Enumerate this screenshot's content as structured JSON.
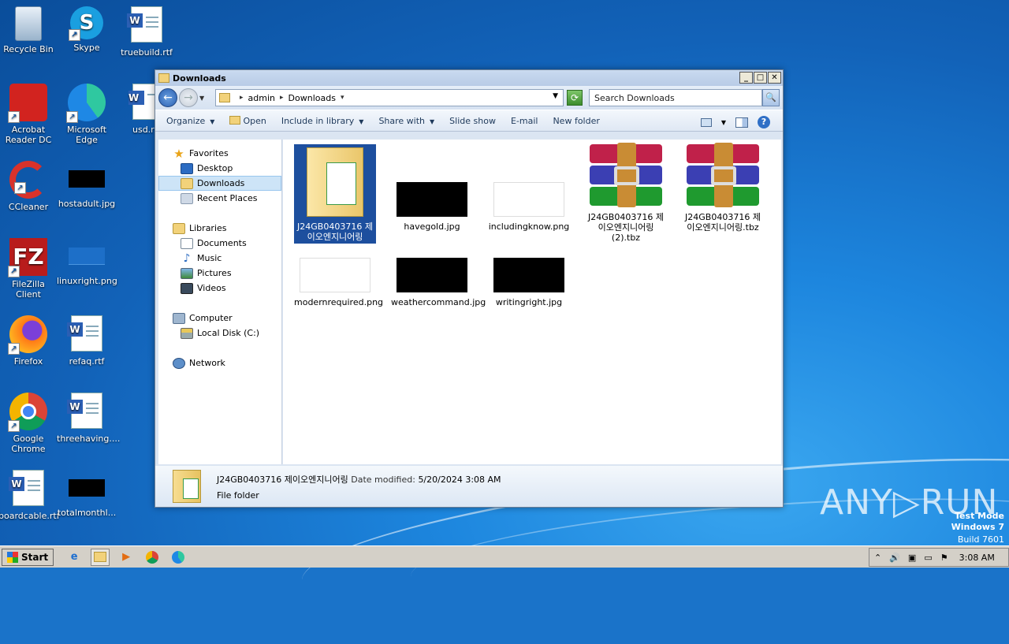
{
  "desktop": {
    "icons": [
      {
        "label": "Recycle Bin"
      },
      {
        "label": "Skype"
      },
      {
        "label": "truebuild.rtf"
      },
      {
        "label": "Acrobat Reader DC"
      },
      {
        "label": "Microsoft Edge"
      },
      {
        "label": "usd.r"
      },
      {
        "label": "CCleaner"
      },
      {
        "label": "hostadult.jpg"
      },
      {
        "label": "FileZilla Client"
      },
      {
        "label": "linuxright.png"
      },
      {
        "label": "Firefox"
      },
      {
        "label": "refaq.rtf"
      },
      {
        "label": "Google Chrome"
      },
      {
        "label": "threehaving...."
      },
      {
        "label": "boardcable.rtf"
      },
      {
        "label": "totalmonthl..."
      }
    ]
  },
  "window": {
    "title": "Downloads",
    "buttons": {
      "minimize": "_",
      "maximize": "□",
      "close": "✕"
    },
    "address": {
      "part1": "admin",
      "part2": "Downloads"
    },
    "search_placeholder": "Search Downloads",
    "toolbar": {
      "organize": "Organize",
      "open": "Open",
      "include": "Include in library",
      "share": "Share with",
      "slideshow": "Slide show",
      "email": "E-mail",
      "newfolder": "New folder"
    },
    "nav": {
      "favorites": "Favorites",
      "desktop": "Desktop",
      "downloads": "Downloads",
      "recent": "Recent Places",
      "libraries": "Libraries",
      "documents": "Documents",
      "music": "Music",
      "pictures": "Pictures",
      "videos": "Videos",
      "computer": "Computer",
      "localdisk": "Local Disk (C:)",
      "network": "Network"
    },
    "files": [
      {
        "name": "J24GB0403716 제이오엔지니어링"
      },
      {
        "name": "havegold.jpg"
      },
      {
        "name": "includingknow.png"
      },
      {
        "name": "J24GB0403716 제이오엔지니어링(2).tbz"
      },
      {
        "name": "J24GB0403716 제이오엔지니어링.tbz"
      },
      {
        "name": "modernrequired.png"
      },
      {
        "name": "weathercommand.jpg"
      },
      {
        "name": "writingright.jpg"
      }
    ],
    "status": {
      "name": "J24GB0403716 제이오엔지니어링",
      "modified_label": "Date modified:",
      "modified": "5/20/2024 3:08 AM",
      "type": "File folder"
    }
  },
  "taskbar": {
    "start": "Start",
    "time": "3:08 AM"
  },
  "watermark": {
    "anyrun": "ANY▷RUN",
    "line1": "Test Mode",
    "line2": "Windows 7",
    "line3": "Build 7601"
  }
}
